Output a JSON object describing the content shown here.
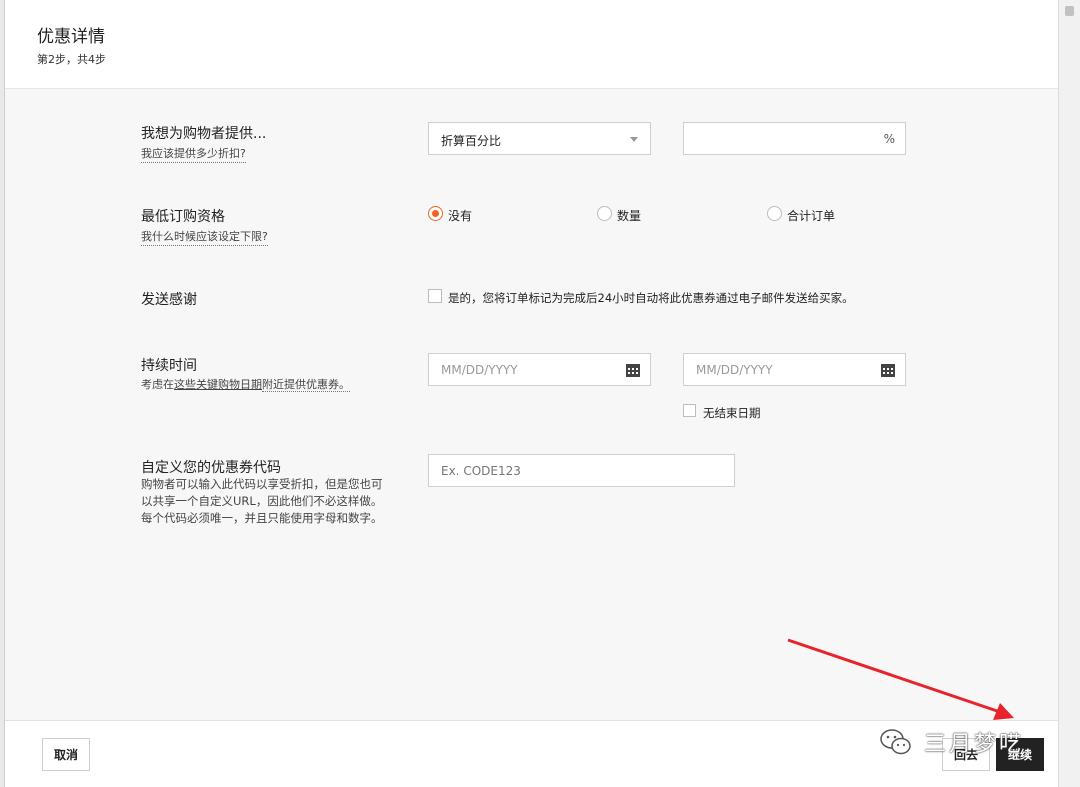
{
  "header": {
    "title": "优惠详情",
    "step": "第2步，共4步"
  },
  "discount": {
    "label": "我想为购物者提供...",
    "help": "我应该提供多少折扣?",
    "type_value": "折算百分比",
    "amount_suffix": "%"
  },
  "minimum": {
    "label": "最低订购资格",
    "help": "我什么时候应该设定下限?",
    "options": [
      "没有",
      "数量",
      "合计订单"
    ],
    "selected": "没有"
  },
  "thanks": {
    "label": "发送感谢",
    "checkbox_label": "是的，您将订单标记为完成后24小时自动将此优惠券通过电子邮件发送给买家。"
  },
  "duration": {
    "label": "持续时间",
    "help_prefix": "考虑在",
    "help_link": "这些关键购物日期",
    "help_suffix": "附近提供优惠券。",
    "start_placeholder": "MM/DD/YYYY",
    "end_placeholder": "MM/DD/YYYY",
    "no_end_label": "无结束日期",
    "calendar_icon": "calendar-icon"
  },
  "code": {
    "label": "自定义您的优惠券代码",
    "description": "购物者可以输入此代码以享受折扣，但是您也可以共享一个自定义URL，因此他们不必这样做。每个代码必须唯一，并且只能使用字母和数字。",
    "placeholder": "Ex. CODE123"
  },
  "footer": {
    "cancel": "取消",
    "back": "回去",
    "continue": "继续"
  },
  "watermark": {
    "text": "三月梦呓",
    "icon": "wechat-icon"
  },
  "colors": {
    "accent": "#f1641e",
    "primary_button": "#222222",
    "arrow": "#e8232a"
  }
}
